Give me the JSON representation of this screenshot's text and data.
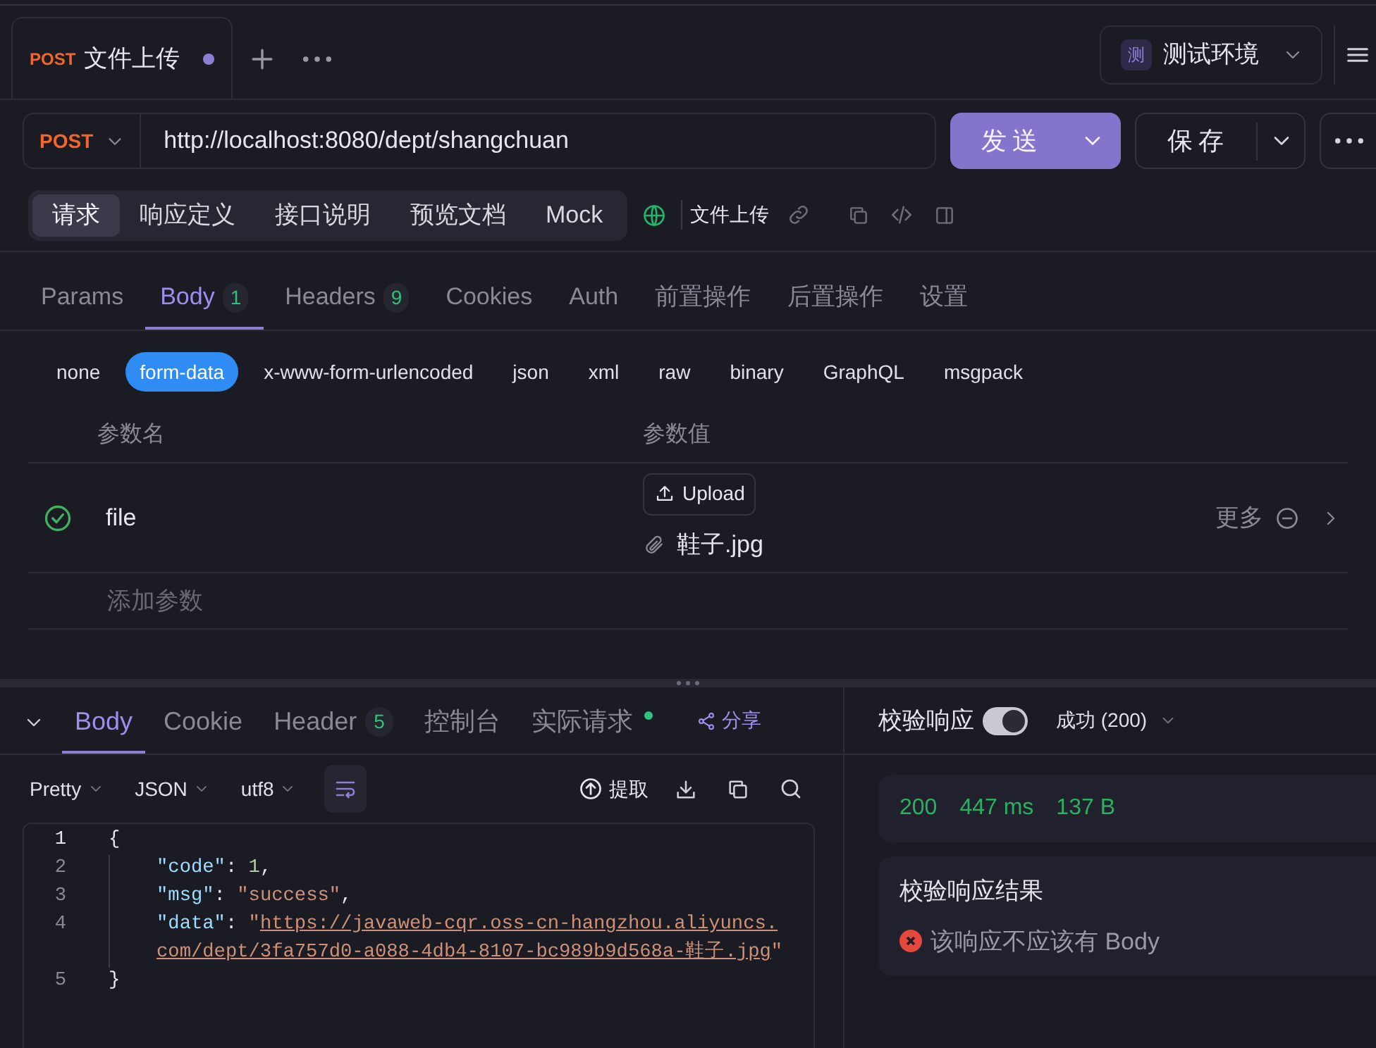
{
  "request_tabs": [
    {
      "method": "POST",
      "title": "文件上传",
      "unsaved": true,
      "selected": true
    }
  ],
  "environment": {
    "badge": "测",
    "name": "测试环境"
  },
  "url_bar": {
    "method": "POST",
    "url": "http://localhost:8080/dept/shangchuan",
    "send": "发送",
    "save": "保存"
  },
  "mode_tabs": [
    {
      "label": "请求",
      "selected": true
    },
    {
      "label": "响应定义",
      "selected": false
    },
    {
      "label": "接口说明",
      "selected": false
    },
    {
      "label": "预览文档",
      "selected": false
    },
    {
      "label": "Mock",
      "selected": false
    }
  ],
  "api_name": "文件上传",
  "param_tabs": [
    {
      "label": "Params",
      "selected": false
    },
    {
      "label": "Body",
      "count": "1",
      "selected": true
    },
    {
      "label": "Headers",
      "count": "9",
      "selected": false
    },
    {
      "label": "Cookies",
      "selected": false
    },
    {
      "label": "Auth",
      "selected": false
    },
    {
      "label": "前置操作",
      "selected": false
    },
    {
      "label": "后置操作",
      "selected": false
    },
    {
      "label": "设置",
      "selected": false
    }
  ],
  "body_types": [
    {
      "label": "none",
      "selected": false
    },
    {
      "label": "form-data",
      "selected": true
    },
    {
      "label": "x-www-form-urlencoded",
      "selected": false
    },
    {
      "label": "json",
      "selected": false
    },
    {
      "label": "xml",
      "selected": false
    },
    {
      "label": "raw",
      "selected": false
    },
    {
      "label": "binary",
      "selected": false
    },
    {
      "label": "GraphQL",
      "selected": false
    },
    {
      "label": "msgpack",
      "selected": false
    }
  ],
  "params_table": {
    "columns": [
      "参数名",
      "参数值"
    ],
    "rows": [
      {
        "enabled": true,
        "name": "file",
        "upload": "Upload",
        "file_name": "鞋子.jpg",
        "more": "更多"
      }
    ],
    "add_placeholder": "添加参数"
  },
  "response": {
    "tabs": [
      {
        "label": "Body",
        "selected": true
      },
      {
        "label": "Cookie",
        "selected": false
      },
      {
        "label": "Header",
        "count": "5",
        "selected": false
      },
      {
        "label": "控制台",
        "selected": false
      },
      {
        "label": "实际请求",
        "indicator": true,
        "selected": false
      }
    ],
    "share": "分享",
    "format_options": [
      "Pretty",
      "JSON",
      "utf8"
    ],
    "extract": "提取",
    "code_lines": [
      {
        "number": "1",
        "tokens": [
          {
            "kind": "punct",
            "text": "{"
          }
        ]
      },
      {
        "number": "2",
        "indent": true,
        "tokens": [
          {
            "kind": "key",
            "text": "\"code\""
          },
          {
            "kind": "punct",
            "text": ": "
          },
          {
            "kind": "number",
            "text": "1"
          },
          {
            "kind": "punct",
            "text": ","
          }
        ]
      },
      {
        "number": "3",
        "indent": true,
        "tokens": [
          {
            "kind": "key",
            "text": "\"msg\""
          },
          {
            "kind": "punct",
            "text": ": "
          },
          {
            "kind": "string",
            "text": "\"success\""
          },
          {
            "kind": "punct",
            "text": ","
          }
        ]
      },
      {
        "number": "4",
        "indent": true,
        "tokens": [
          {
            "kind": "key",
            "text": "\"data\""
          },
          {
            "kind": "punct",
            "text": ": "
          },
          {
            "kind": "string",
            "text": "\""
          },
          {
            "kind": "link",
            "text": "https://javaweb-cqr.oss-cn-hangzhou.aliyuncs.com/dept/3fa757d0-a088-4db4-8107-bc989b9d568a-鞋子.jpg"
          },
          {
            "kind": "string",
            "text": "\""
          }
        ]
      },
      {
        "number": "5",
        "tokens": [
          {
            "kind": "punct",
            "text": "}"
          }
        ]
      }
    ]
  },
  "validation": {
    "label": "校验响应",
    "on": true,
    "expected": "成功 (200)",
    "status": "200",
    "time": "447 ms",
    "size": "137 B",
    "result_title": "校验响应结果",
    "result_message": "该响应不应该有 Body",
    "passed": false
  }
}
